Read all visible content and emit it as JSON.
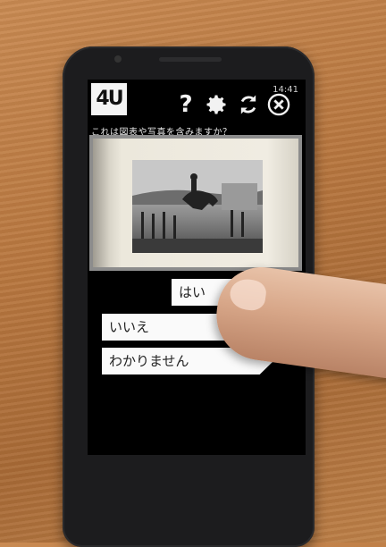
{
  "status_bar": {
    "time": "14:41"
  },
  "app": {
    "logo_text": "4U"
  },
  "toolbar": {
    "help_label": "?"
  },
  "question": {
    "text": "これは図表や写真を含みますか？"
  },
  "answers": [
    {
      "label": "はい"
    },
    {
      "label": "いいえ"
    },
    {
      "label": "わかりません"
    }
  ],
  "colors": {
    "screen_bg": "#000000",
    "button_bg": "#fafafa"
  }
}
